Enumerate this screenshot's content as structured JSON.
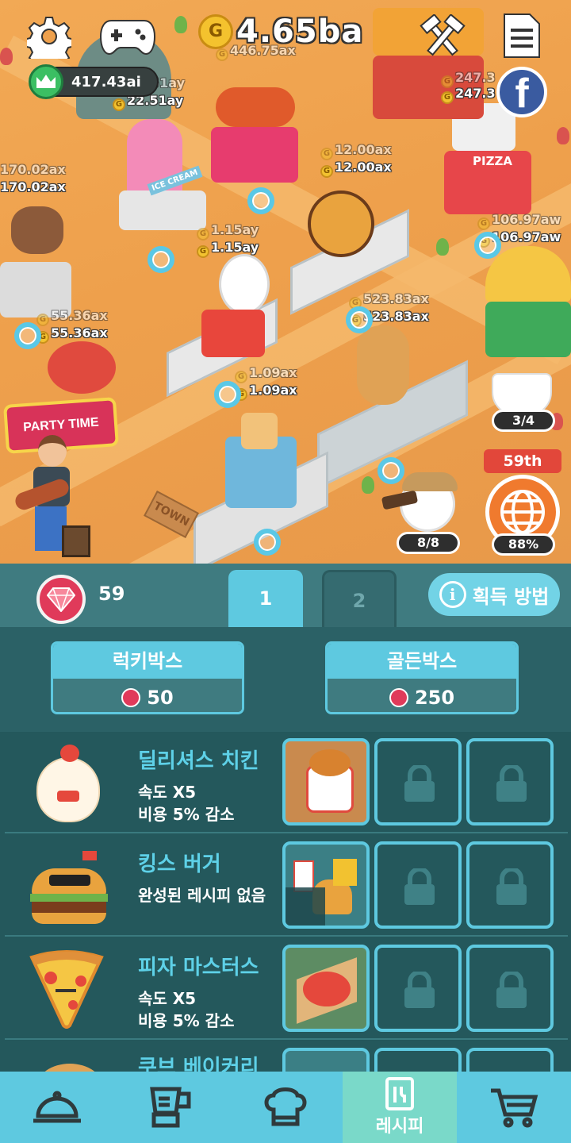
{
  "hud": {
    "gold_total": "4.65ba",
    "gold_ghost": "446.75ax",
    "crown_value": "417.43ai",
    "coin_glyph": "G"
  },
  "map": {
    "earnings": [
      {
        "id": "icecream-ghost",
        "text": "51ay",
        "ghost": true
      },
      {
        "id": "icecream",
        "text": "22.51ay"
      },
      {
        "id": "pizza-ghost",
        "text": "247.3",
        "ghost": true
      },
      {
        "id": "pizza",
        "text": "247.3"
      },
      {
        "id": "burger-ghost",
        "text": "12.00ax",
        "ghost": true
      },
      {
        "id": "burger",
        "text": "12.00ax"
      },
      {
        "id": "left-ghost",
        "text": "170.02ax",
        "ghost": true
      },
      {
        "id": "left",
        "text": "170.02ax"
      },
      {
        "id": "taco-ghost",
        "text": "106.97aw",
        "ghost": true
      },
      {
        "id": "taco",
        "text": "106.97aw"
      },
      {
        "id": "chicken-ghost",
        "text": "1.15ay",
        "ghost": true
      },
      {
        "id": "chicken",
        "text": "1.15ay"
      },
      {
        "id": "drink-ghost",
        "text": "523.83ax",
        "ghost": true
      },
      {
        "id": "drink",
        "text": "523.83ax"
      },
      {
        "id": "coffee-ghost",
        "text": "55.36ax",
        "ghost": true
      },
      {
        "id": "coffee",
        "text": "55.36ax"
      },
      {
        "id": "fries-ghost",
        "text": "1.09ax",
        "ghost": true
      },
      {
        "id": "fries",
        "text": "1.09ax"
      }
    ],
    "signs": {
      "ice_cream": "ICE CREAM",
      "pizza": "PIZZA",
      "town": "TOWN",
      "party_time": "PARTY TIME"
    },
    "coffee_counter": "3/4",
    "explorer_counter": "8/8",
    "rank": "59th",
    "globe_percent": "88%"
  },
  "gems": {
    "count": "59"
  },
  "tabs": [
    {
      "label": "1",
      "active": true
    },
    {
      "label": "2",
      "active": false
    }
  ],
  "howto_label": "획득 방법",
  "boxes": [
    {
      "label": "럭키박스",
      "price": "50"
    },
    {
      "label": "골든박스",
      "price": "250"
    }
  ],
  "recipes": [
    {
      "name": "딜리셔스 치킨",
      "d1": "속도 X5",
      "d2": "비용 5% 감소"
    },
    {
      "name": "킹스 버거",
      "d1": "완성된 레시피 없음",
      "d2": ""
    },
    {
      "name": "피자 마스터스",
      "d1": "속도 X5",
      "d2": "비용 5% 감소"
    },
    {
      "name": "쿠브 베이커리",
      "d1": "",
      "d2": ""
    }
  ],
  "nav": {
    "active_label": "레시피",
    "items": [
      "serving-cloche-icon",
      "blender-icon",
      "chef-hat-icon",
      "recipe-book-icon",
      "shopping-cart-icon"
    ]
  },
  "colors": {
    "accent": "#5ec9e0",
    "panel": "#24585c",
    "gem": "#e03a5a",
    "map": "#eea04c"
  }
}
